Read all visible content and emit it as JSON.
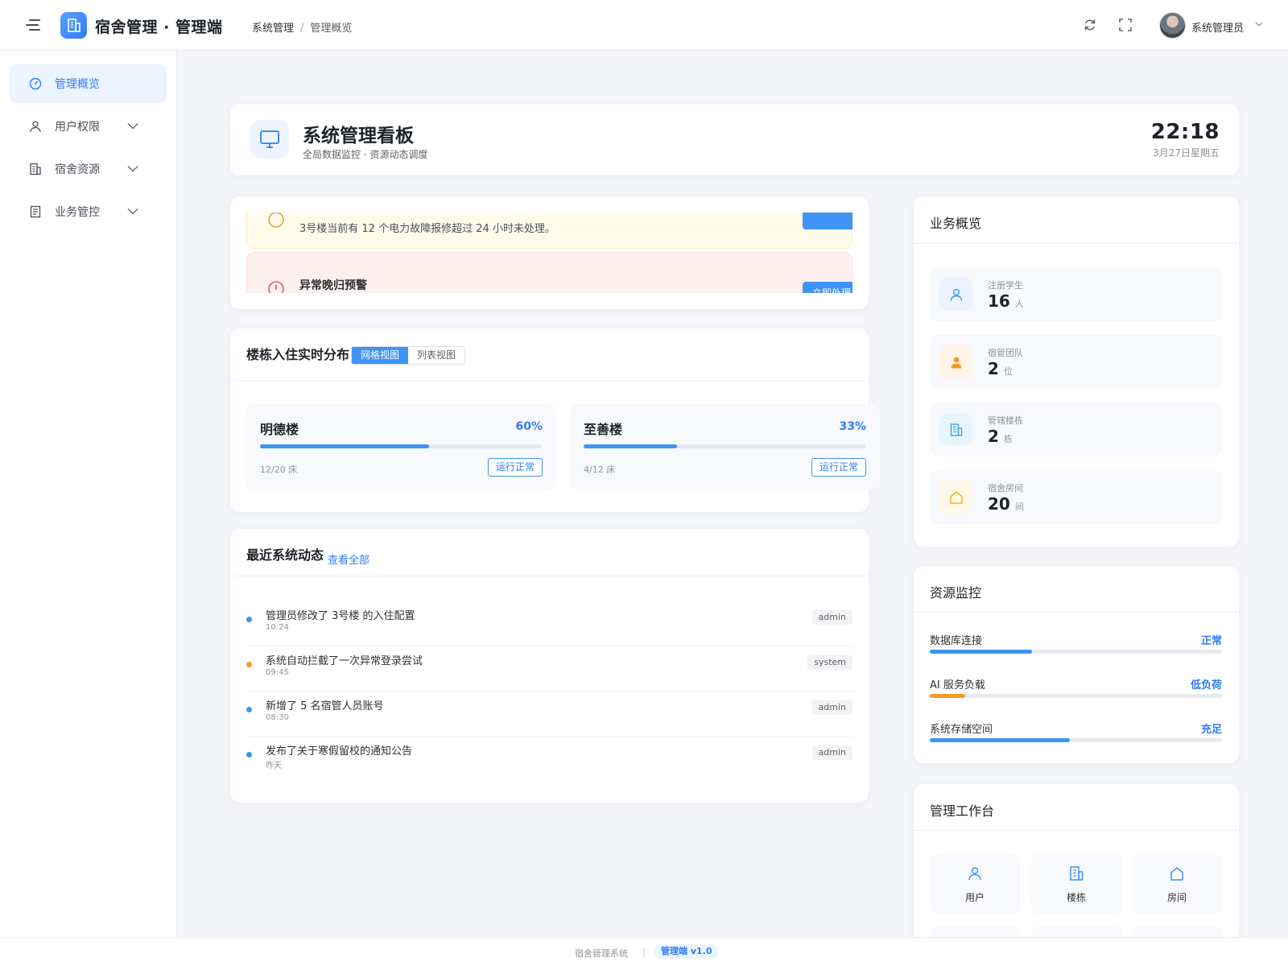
{
  "header": {
    "app_title": "宿舍管理 · 管理端",
    "breadcrumb": [
      "系统管理",
      "管理概览"
    ],
    "user_name": "系统管理员"
  },
  "sidebar": {
    "items": [
      {
        "label": "管理概览",
        "icon": "dashboard-icon",
        "active": true
      },
      {
        "label": "用户权限",
        "icon": "user-icon",
        "active": false
      },
      {
        "label": "宿舍资源",
        "icon": "building-icon",
        "active": false
      },
      {
        "label": "业务管控",
        "icon": "document-icon",
        "active": false
      }
    ]
  },
  "welcome": {
    "title": "系统管理看板",
    "subtitle": "全局数据监控 · 资源动态调度",
    "time": "22:18",
    "date": "3月27日星期五"
  },
  "alerts": [
    {
      "type": "warning",
      "text": "3号楼当前有 12 个电力故障报修超过 24 小时未处理。",
      "button": ""
    },
    {
      "type": "danger",
      "title": "异常晚归预警",
      "button": "立即处理"
    }
  ],
  "occupancy": {
    "title": "楼栋入住实时分布",
    "views": [
      "网格视图",
      "列表视图"
    ],
    "active_view": 0,
    "buildings": [
      {
        "name": "明德楼",
        "percent_label": "60%",
        "percent": 60,
        "beds": "12/20 床",
        "status": "运行正常"
      },
      {
        "name": "至善楼",
        "percent_label": "33%",
        "percent": 33,
        "beds": "4/12 床",
        "status": "运行正常"
      }
    ]
  },
  "activity": {
    "title": "最近系统动态",
    "view_all": "查看全部",
    "items": [
      {
        "text": "管理员修改了 3号楼 的入住配置",
        "time": "10:24",
        "tag": "admin",
        "color": "#3f93f5"
      },
      {
        "text": "系统自动拦截了一次异常登录尝试",
        "time": "09:45",
        "tag": "system",
        "color": "#f59a23"
      },
      {
        "text": "新增了 5 名宿管人员账号",
        "time": "08:30",
        "tag": "admin",
        "color": "#3f93f5"
      },
      {
        "text": "发布了关于寒假留校的通知公告",
        "time": "昨天",
        "tag": "admin",
        "color": "#3f93f5"
      }
    ]
  },
  "business": {
    "title": "业务概览",
    "stats": [
      {
        "label": "注册学生",
        "value": "16",
        "unit": "人",
        "icon": "user-icon",
        "color": "#3f93f5",
        "bg": "#eaf3ff"
      },
      {
        "label": "宿管团队",
        "value": "2",
        "unit": "位",
        "icon": "staff-icon",
        "color": "#f59a23",
        "bg": "#fff4e5"
      },
      {
        "label": "管辖楼栋",
        "value": "2",
        "unit": "栋",
        "icon": "building-icon",
        "color": "#3fa3e8",
        "bg": "#e8f5fd"
      },
      {
        "label": "宿舍房间",
        "value": "20",
        "unit": "间",
        "icon": "home-icon",
        "color": "#f0b429",
        "bg": "#fff8e6"
      }
    ]
  },
  "resources": {
    "title": "资源监控",
    "items": [
      {
        "label": "数据库连接",
        "status": "正常",
        "percent": 35,
        "color": "#3f93f5"
      },
      {
        "label": "AI 服务负载",
        "status": "低负荷",
        "percent": 12,
        "color": "#f59a23"
      },
      {
        "label": "系统存储空间",
        "status": "充足",
        "percent": 48,
        "color": "#3f93f5"
      }
    ]
  },
  "workbench": {
    "title": "管理工作台",
    "buttons": [
      {
        "label": "用户",
        "icon": "user-icon"
      },
      {
        "label": "楼栋",
        "icon": "building-icon"
      },
      {
        "label": "房间",
        "icon": "home-icon"
      }
    ]
  },
  "footer": {
    "system": "宿舍管理系统",
    "version": "管理端 v1.0"
  }
}
